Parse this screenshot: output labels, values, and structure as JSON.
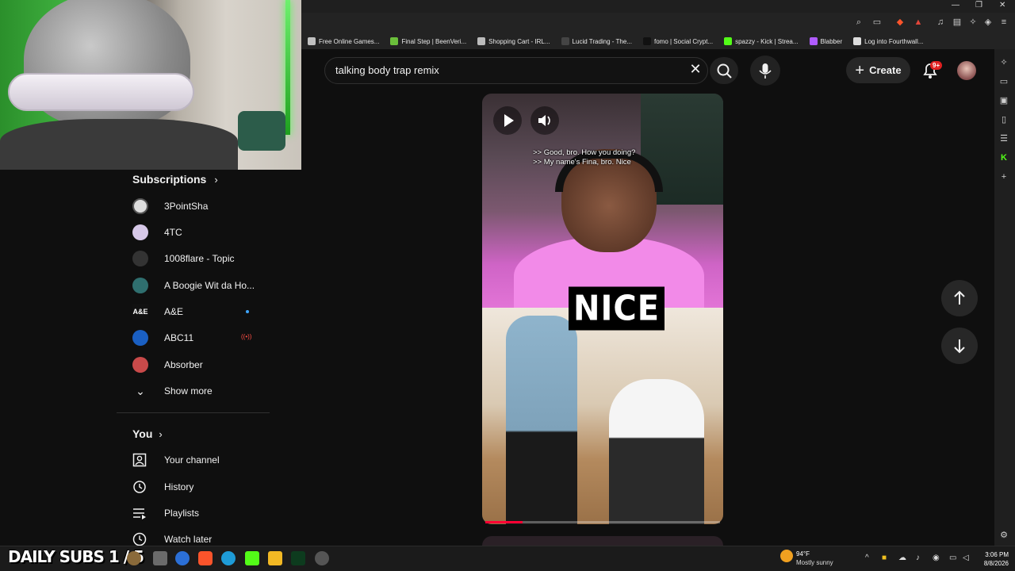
{
  "overlay": {
    "daily_subs": "DAILY SUBS 1 / 5"
  },
  "bookmarks": [
    {
      "label": "Free Online Games...",
      "color": "#c0c0c0"
    },
    {
      "label": "Final Step | BeenVeri...",
      "color": "#6bbf3b"
    },
    {
      "label": "Shopping Cart - IRL...",
      "color": "#bbbbbb"
    },
    {
      "label": "Lucid Trading - The...",
      "color": "#444444"
    },
    {
      "label": "fomo | Social Crypt...",
      "color": "#111111"
    },
    {
      "label": "spazzy - Kick | Strea...",
      "color": "#53fc18"
    },
    {
      "label": "Blabber",
      "color": "#b05cff"
    },
    {
      "label": "Log into Fourthwall...",
      "color": "#dddddd"
    }
  ],
  "header": {
    "search_value": "talking body trap remix",
    "create_label": "Create",
    "notifications_badge": "9+"
  },
  "sidebar": {
    "subscriptions_title": "Subscriptions",
    "subscriptions": [
      {
        "name": "3PointSha",
        "color": "#dddddd"
      },
      {
        "name": "4TC",
        "color": "#d6c8e8"
      },
      {
        "name": "1008flare - Topic",
        "color": "#333333"
      },
      {
        "name": "A Boogie Wit da Ho...",
        "color": "#2f6f6f"
      },
      {
        "name": "A&E",
        "color": "#111111"
      },
      {
        "name": "ABC11",
        "color": "#1a5fc2"
      },
      {
        "name": "Absorber",
        "color": "#c94a4a"
      }
    ],
    "show_more": "Show more",
    "you_title": "You",
    "you_items": [
      {
        "label": "Your channel",
        "icon": "person-box-icon"
      },
      {
        "label": "History",
        "icon": "history-icon"
      },
      {
        "label": "Playlists",
        "icon": "playlists-icon"
      },
      {
        "label": "Watch later",
        "icon": "clock-icon"
      }
    ]
  },
  "video": {
    "caption_line1": ">> Good, bro. How you doing?",
    "caption_line2": ">> My name's Fina, bro. Nice",
    "overlay_text": "NICE",
    "progress": 0.16
  },
  "taskbar": {
    "weather_temp": "94°F",
    "weather_desc": "Mostly sunny",
    "time": "3:06 PM",
    "date": "8/8/2026"
  },
  "colors": {
    "accent": "#ff0033",
    "background": "#0f0f0f"
  }
}
